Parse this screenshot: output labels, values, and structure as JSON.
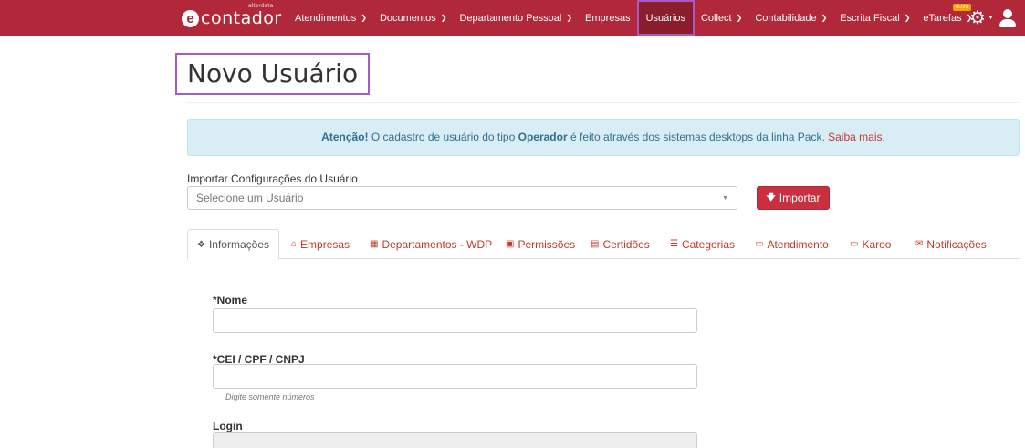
{
  "navbar": {
    "logo_text": "contador",
    "logo_superscript": "alterdata",
    "items": [
      {
        "label": "Atendimentos",
        "dropdown": true
      },
      {
        "label": "Documentos",
        "dropdown": true
      },
      {
        "label": "Departamento Pessoal",
        "dropdown": true
      },
      {
        "label": "Empresas",
        "dropdown": false
      },
      {
        "label": "Usuários",
        "dropdown": false,
        "active": true
      },
      {
        "label": "Collect",
        "dropdown": true
      },
      {
        "label": "Contabilidade",
        "dropdown": true
      },
      {
        "label": "Escrita Fiscal",
        "dropdown": true
      },
      {
        "label": "eTarefas",
        "dropdown": true,
        "badge": "NOVO"
      }
    ],
    "icons": [
      "gear-icon",
      "user-icon"
    ]
  },
  "page": {
    "title": "Novo Usuário"
  },
  "alert": {
    "strong": "Atenção!",
    "text_before": " O cadastro de usuário do tipo ",
    "emphasis": "Operador",
    "text_after": " é feito através dos sistemas desktops da linha Pack. ",
    "link": "Saiba mais."
  },
  "import": {
    "label": "Importar Configurações do Usuário",
    "select_placeholder": "Selecione um Usuário",
    "button_label": "Importar"
  },
  "tabs": [
    {
      "label": "Informações",
      "icon": "info-circle-icon",
      "active": true
    },
    {
      "label": "Empresas",
      "icon": "home-icon"
    },
    {
      "label": "Departamentos - WDP",
      "icon": "building-icon"
    },
    {
      "label": "Permissões",
      "icon": "lock-icon"
    },
    {
      "label": "Certidões",
      "icon": "file-text-icon"
    },
    {
      "label": "Categorias",
      "icon": "list-icon"
    },
    {
      "label": "Atendimento",
      "icon": "desktop-icon"
    },
    {
      "label": "Karoo",
      "icon": "desktop-icon"
    },
    {
      "label": "Notificações",
      "icon": "envelope-icon"
    }
  ],
  "form": {
    "nome_label": "*Nome",
    "nome_value": "",
    "doc_label": "*CEI / CPF / CNPJ",
    "doc_value": "",
    "doc_help": "Digite somente números",
    "login_label": "Login",
    "login_value": ""
  },
  "colors": {
    "navbar": "#b0283a",
    "accent": "#c0392b",
    "alert_bg": "#d9edf7",
    "highlight": "#a45cc4"
  }
}
